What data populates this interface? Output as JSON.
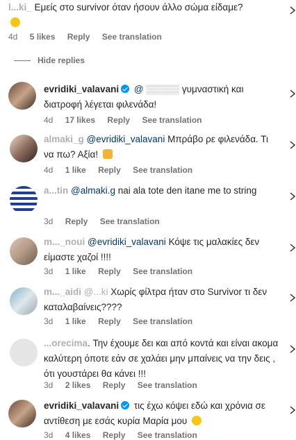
{
  "top_comment": {
    "username": "l...ki_",
    "text": "Εμείς στο survivor όταν ήσουν άλλο σώμα είδαμε?",
    "emoji": "thinking-face",
    "meta": {
      "time": "4d",
      "likes": "5 likes",
      "reply": "Reply",
      "translate": "See translation"
    }
  },
  "hide_replies": "Hide replies",
  "replies": [
    {
      "username": "evridiki_valavani",
      "verified": true,
      "mention": "@",
      "text": "γυμναστική και διατροφή λέγεται φιλενάδα!",
      "meta": {
        "time": "4d",
        "likes": "17 likes",
        "reply": "Reply",
        "translate": "See translation"
      }
    },
    {
      "username": "almaki_g",
      "mention": "@evridiki_valavani",
      "text": "Μπράβο ρε φιλενάδα. Τι να πω? Αξία!",
      "emoji": "clapping-hands",
      "meta": {
        "time": "4d",
        "likes": "1 like",
        "reply": "Reply",
        "translate": "See translation"
      }
    },
    {
      "username": "a...tin",
      "mention": "@almaki.g",
      "text": "nai ala tote den itane me to string",
      "meta": {
        "time": "3d",
        "reply": "Reply",
        "translate": "See translation"
      }
    },
    {
      "username": "m..._noui",
      "mention": "@evridiki_valavani",
      "text": "Κόψε τις μαλακίες δεν είμαστε χαζοί !!!!",
      "meta": {
        "time": "3d",
        "likes": "1 like",
        "reply": "Reply",
        "translate": "See translation"
      }
    },
    {
      "username": "m..._aidi",
      "mention": "@...ki",
      "text": "Χωρίς φίλτρα ήταν στο Survivor τι δεν καταλαβαίνεις????",
      "meta": {
        "time": "3d",
        "likes": "1 like",
        "reply": "Reply",
        "translate": "See translation"
      }
    },
    {
      "username": "...orecima",
      "mention": "",
      "text": ". Την έχουμε δει και από κοντά και είναι ακομα καλύτερη όποτε εάν σε χαλάει μην μπαίνεις να την δεις , ότι γουστάρει θα κάνει !!!",
      "meta": {
        "time": "3d",
        "likes": "2 likes",
        "reply": "Reply",
        "translate": "See translation"
      }
    },
    {
      "username": "evridiki_valavani",
      "verified": true,
      "text": "τις έχω κόψει εδώ και χρόνια σε αντίθεση με εσάς κυρία Μαρία μου",
      "emoji": "grinning-face",
      "meta": {
        "time": "3d",
        "likes": "4 likes",
        "reply": "Reply",
        "translate": "See translation"
      }
    }
  ]
}
